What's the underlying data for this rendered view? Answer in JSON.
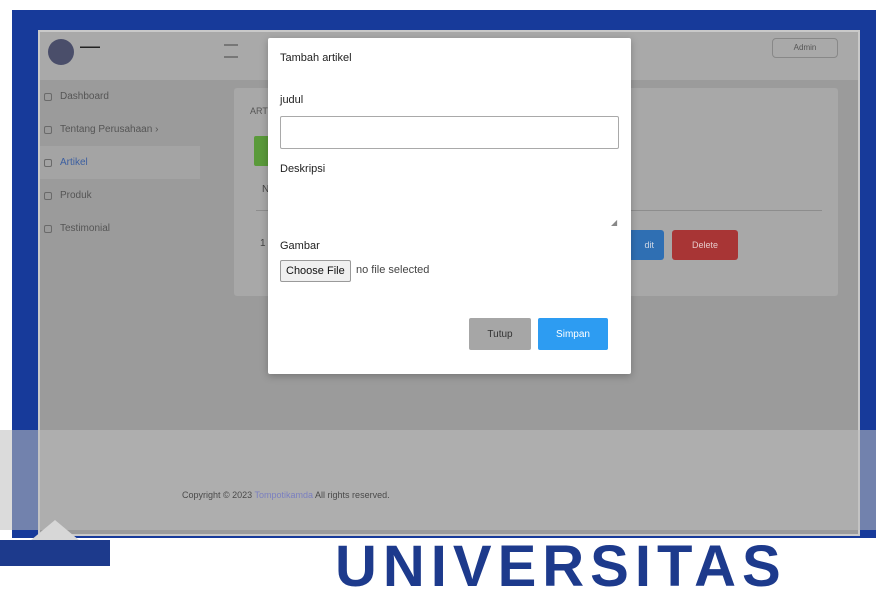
{
  "app": {
    "user_menu_label": "Admin",
    "sidebar": [
      {
        "label": "Dashboard",
        "active": false
      },
      {
        "label": "Tentang Perusahaan",
        "active": false,
        "has_submenu": true
      },
      {
        "label": "Artikel",
        "active": true
      },
      {
        "label": "Produk",
        "active": false
      },
      {
        "label": "Testimonial",
        "active": false
      }
    ],
    "card_title": "ART",
    "table": {
      "header_first_col": "N",
      "row_number": "1",
      "edit_label": "dit",
      "delete_label": "Delete"
    },
    "footer": {
      "prefix": "Copyright © 2023",
      "link": "Tompotikamda",
      "suffix": " All rights reserved."
    }
  },
  "modal": {
    "title": "Tambah artikel",
    "judul_label": "judul",
    "judul_value": "",
    "deskripsi_label": "Deskripsi",
    "deskripsi_value": "",
    "gambar_label": "Gambar",
    "file_button": "Choose File",
    "file_status": "no file selected",
    "close_button": "Tutup",
    "save_button": "Simpan"
  },
  "watermark": "UNIVERSITAS",
  "colors": {
    "frame": "#173a9a",
    "save_button": "#2d9cf2",
    "close_button": "#a6a6a6",
    "delete_button": "#a83535",
    "edit_button": "#2f6fb3"
  }
}
